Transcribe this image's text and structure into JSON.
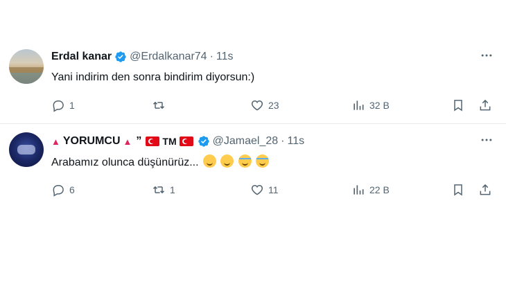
{
  "tweets": [
    {
      "name": "Erdal kanar",
      "handle": "@Erdalkanar74",
      "dot": "·",
      "time": "11s",
      "text": "Yani indirim den sonra bindirim diyorsun:)",
      "replies": "1",
      "reposts": "",
      "likes": "23",
      "views": "32 B"
    },
    {
      "name_prefix": "▲",
      "name": "YORUMCU",
      "name_suffix": "▲",
      "quote": "”",
      "tm": "TM",
      "handle": "@Jamael_28",
      "dot": "·",
      "time": "11s",
      "text": "Arabamız olunca düşünürüz...",
      "replies": "6",
      "reposts": "1",
      "likes": "11",
      "views": "22 B"
    }
  ],
  "icons": {
    "verified": "verified-badge-icon",
    "more": "more-options-icon",
    "reply": "reply-icon",
    "repost": "repost-icon",
    "like": "heart-icon",
    "views": "views-chart-icon",
    "bookmark": "bookmark-icon",
    "share": "share-icon"
  },
  "colors": {
    "accent": "#1d9bf0",
    "muted": "#536471",
    "text": "#0f1419",
    "flag": "#e30a17"
  }
}
